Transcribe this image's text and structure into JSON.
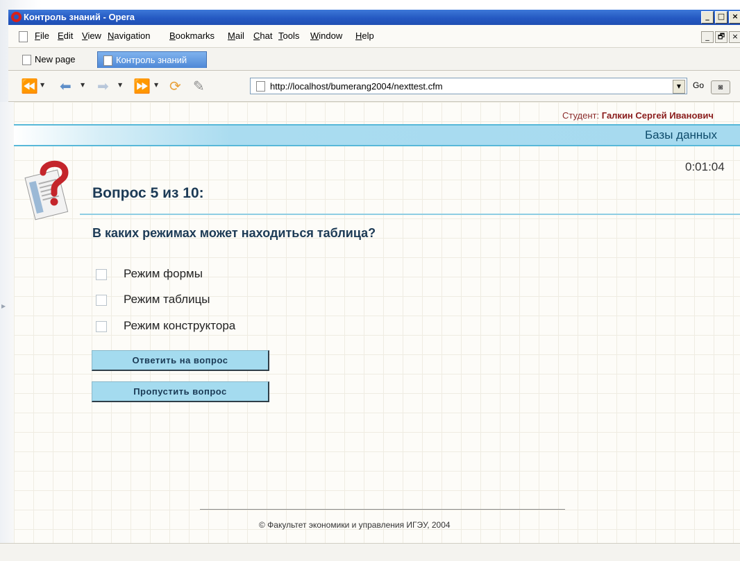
{
  "window": {
    "title": "Контроль знаний - Opera",
    "controls": [
      "_",
      "□",
      "×"
    ]
  },
  "menu": {
    "items": [
      "File",
      "Edit",
      "View",
      "Navigation",
      "Bookmarks",
      "Mail",
      "Chat",
      "Tools",
      "Window",
      "Help"
    ],
    "underlined_letters": [
      "F",
      "E",
      "V",
      "N",
      "B",
      "M",
      "C",
      "T",
      "W",
      "H"
    ],
    "mdi_controls": [
      "_",
      "🗗",
      "×"
    ]
  },
  "tabs": [
    {
      "label": "New page",
      "active": false
    },
    {
      "label": "Контроль знаний",
      "active": true
    }
  ],
  "nav": {
    "url": "http://localhost/bumerang2004/nexttest.cfm",
    "go_label": "Go"
  },
  "page": {
    "student_prefix": "Студент:",
    "student_name": "Галкин Сергей Иванович",
    "subject": "Базы данных",
    "timer": "0:01:04",
    "question_number": "Вопрос 5 из 10:",
    "question_text": "В каких режимах может находиться таблица?",
    "options": [
      {
        "label": "Режим формы",
        "checked": false
      },
      {
        "label": "Режим таблицы",
        "checked": false
      },
      {
        "label": "Режим конструктора",
        "checked": false
      }
    ],
    "answer_button": "Ответить на вопрос",
    "skip_button": "Пропустить вопрос",
    "footer": "© Факультет экономики и управления ИГЭУ, 2004"
  },
  "colors": {
    "accent": "#57b8d8",
    "button_bg": "#a4dbef",
    "heading": "#1c3a55",
    "student_name": "#8a1c1c"
  }
}
